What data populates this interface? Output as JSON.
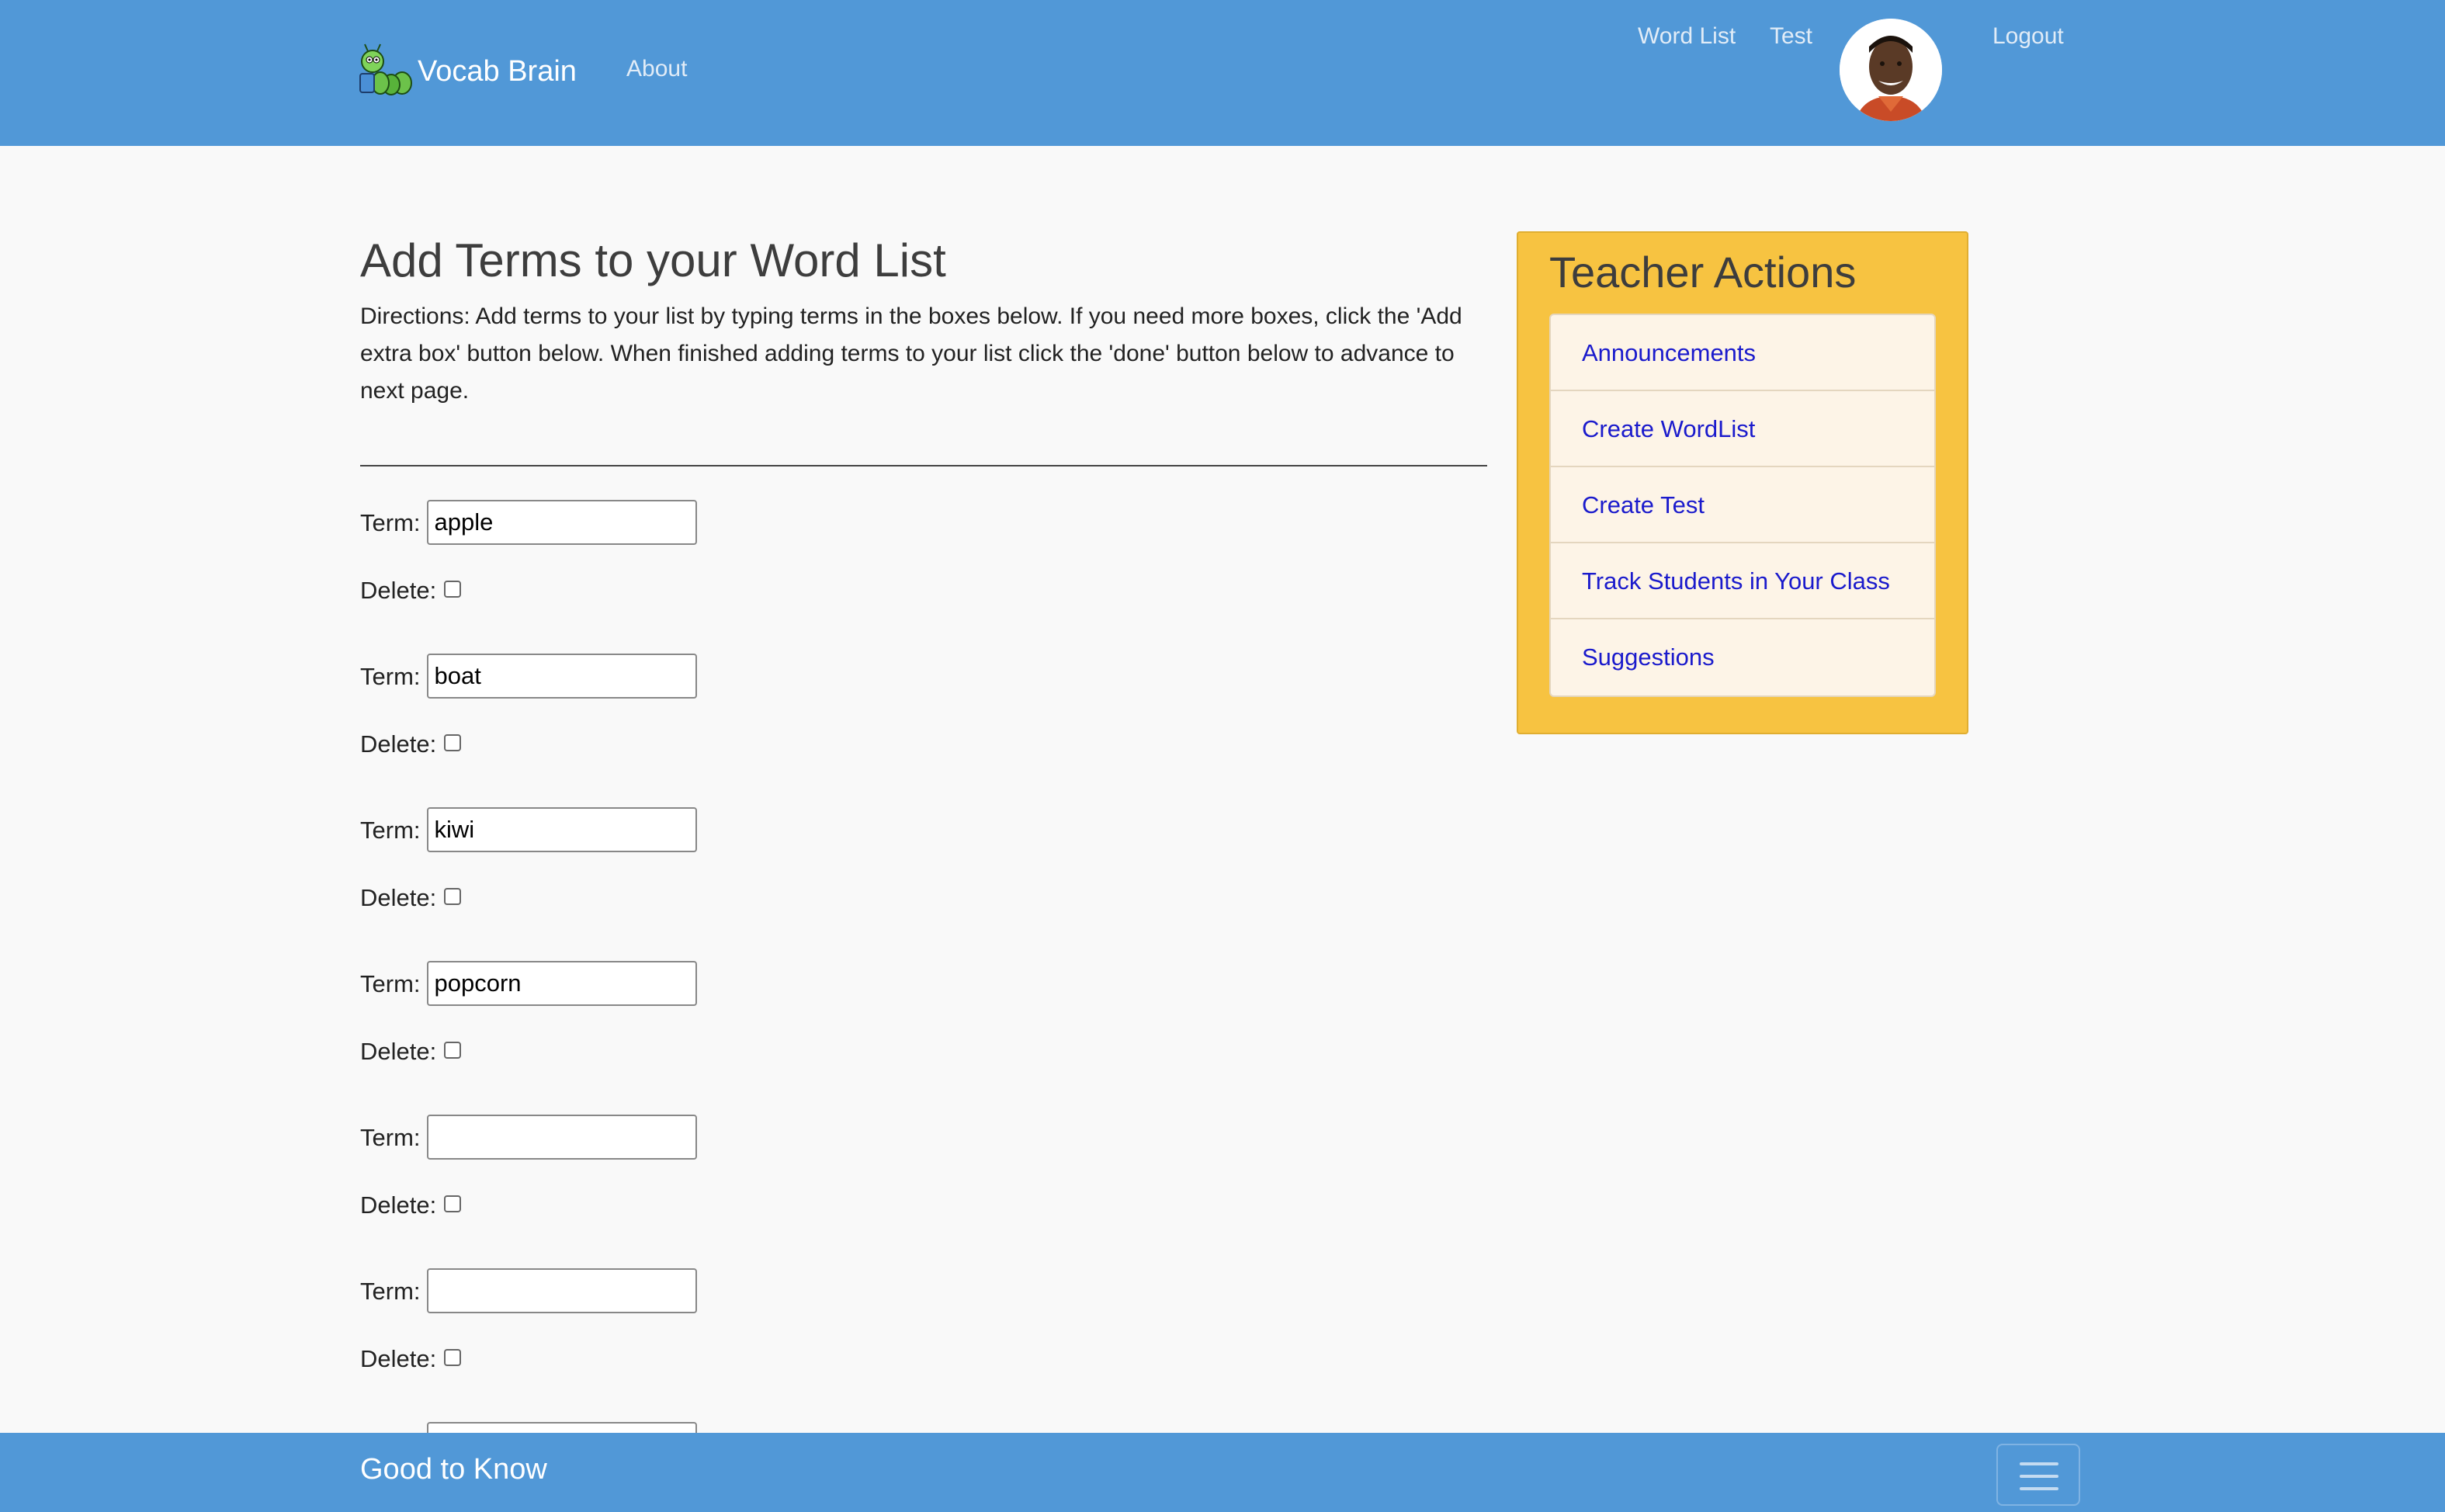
{
  "navbar": {
    "brand": "Vocab Brain",
    "about": "About",
    "word_list": "Word List",
    "test": "Test",
    "logout": "Logout",
    "bg_color": "#5198d7"
  },
  "main": {
    "title": "Add Terms to your Word List",
    "directions": "Directions: Add terms to your list by typing terms in the boxes below. If you need more boxes, click the 'Add extra box' button below. When finished adding terms to your list click the 'done' button below to advance to next page.",
    "term_label": "Term:",
    "delete_label": "Delete:",
    "terms": [
      {
        "value": "apple",
        "delete": false
      },
      {
        "value": "boat",
        "delete": false
      },
      {
        "value": "kiwi",
        "delete": false
      },
      {
        "value": "popcorn",
        "delete": false
      },
      {
        "value": "",
        "delete": false
      },
      {
        "value": "",
        "delete": false
      }
    ]
  },
  "panel": {
    "title": "Teacher Actions",
    "bg_color": "#f7c341",
    "items": [
      {
        "label": "Announcements"
      },
      {
        "label": "Create WordList"
      },
      {
        "label": "Create Test"
      },
      {
        "label": "Track Students in Your Class"
      },
      {
        "label": "Suggestions"
      }
    ]
  },
  "footer": {
    "title": "Good to Know",
    "menu_icon": "hamburger-menu-icon"
  }
}
